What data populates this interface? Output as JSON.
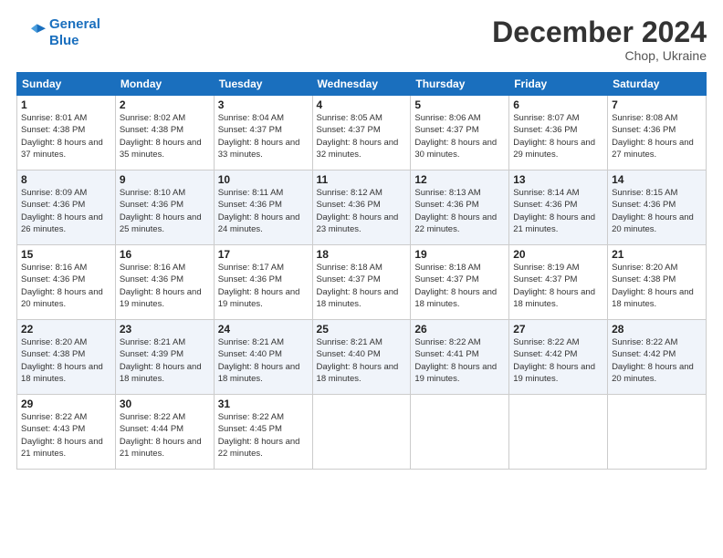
{
  "header": {
    "logo_line1": "General",
    "logo_line2": "Blue",
    "month": "December 2024",
    "location": "Chop, Ukraine"
  },
  "weekdays": [
    "Sunday",
    "Monday",
    "Tuesday",
    "Wednesday",
    "Thursday",
    "Friday",
    "Saturday"
  ],
  "weeks": [
    [
      {
        "day": "1",
        "sunrise": "8:01 AM",
        "sunset": "4:38 PM",
        "daylight": "8 hours and 37 minutes."
      },
      {
        "day": "2",
        "sunrise": "8:02 AM",
        "sunset": "4:38 PM",
        "daylight": "8 hours and 35 minutes."
      },
      {
        "day": "3",
        "sunrise": "8:04 AM",
        "sunset": "4:37 PM",
        "daylight": "8 hours and 33 minutes."
      },
      {
        "day": "4",
        "sunrise": "8:05 AM",
        "sunset": "4:37 PM",
        "daylight": "8 hours and 32 minutes."
      },
      {
        "day": "5",
        "sunrise": "8:06 AM",
        "sunset": "4:37 PM",
        "daylight": "8 hours and 30 minutes."
      },
      {
        "day": "6",
        "sunrise": "8:07 AM",
        "sunset": "4:36 PM",
        "daylight": "8 hours and 29 minutes."
      },
      {
        "day": "7",
        "sunrise": "8:08 AM",
        "sunset": "4:36 PM",
        "daylight": "8 hours and 27 minutes."
      }
    ],
    [
      {
        "day": "8",
        "sunrise": "8:09 AM",
        "sunset": "4:36 PM",
        "daylight": "8 hours and 26 minutes."
      },
      {
        "day": "9",
        "sunrise": "8:10 AM",
        "sunset": "4:36 PM",
        "daylight": "8 hours and 25 minutes."
      },
      {
        "day": "10",
        "sunrise": "8:11 AM",
        "sunset": "4:36 PM",
        "daylight": "8 hours and 24 minutes."
      },
      {
        "day": "11",
        "sunrise": "8:12 AM",
        "sunset": "4:36 PM",
        "daylight": "8 hours and 23 minutes."
      },
      {
        "day": "12",
        "sunrise": "8:13 AM",
        "sunset": "4:36 PM",
        "daylight": "8 hours and 22 minutes."
      },
      {
        "day": "13",
        "sunrise": "8:14 AM",
        "sunset": "4:36 PM",
        "daylight": "8 hours and 21 minutes."
      },
      {
        "day": "14",
        "sunrise": "8:15 AM",
        "sunset": "4:36 PM",
        "daylight": "8 hours and 20 minutes."
      }
    ],
    [
      {
        "day": "15",
        "sunrise": "8:16 AM",
        "sunset": "4:36 PM",
        "daylight": "8 hours and 20 minutes."
      },
      {
        "day": "16",
        "sunrise": "8:16 AM",
        "sunset": "4:36 PM",
        "daylight": "8 hours and 19 minutes."
      },
      {
        "day": "17",
        "sunrise": "8:17 AM",
        "sunset": "4:36 PM",
        "daylight": "8 hours and 19 minutes."
      },
      {
        "day": "18",
        "sunrise": "8:18 AM",
        "sunset": "4:37 PM",
        "daylight": "8 hours and 18 minutes."
      },
      {
        "day": "19",
        "sunrise": "8:18 AM",
        "sunset": "4:37 PM",
        "daylight": "8 hours and 18 minutes."
      },
      {
        "day": "20",
        "sunrise": "8:19 AM",
        "sunset": "4:37 PM",
        "daylight": "8 hours and 18 minutes."
      },
      {
        "day": "21",
        "sunrise": "8:20 AM",
        "sunset": "4:38 PM",
        "daylight": "8 hours and 18 minutes."
      }
    ],
    [
      {
        "day": "22",
        "sunrise": "8:20 AM",
        "sunset": "4:38 PM",
        "daylight": "8 hours and 18 minutes."
      },
      {
        "day": "23",
        "sunrise": "8:21 AM",
        "sunset": "4:39 PM",
        "daylight": "8 hours and 18 minutes."
      },
      {
        "day": "24",
        "sunrise": "8:21 AM",
        "sunset": "4:40 PM",
        "daylight": "8 hours and 18 minutes."
      },
      {
        "day": "25",
        "sunrise": "8:21 AM",
        "sunset": "4:40 PM",
        "daylight": "8 hours and 18 minutes."
      },
      {
        "day": "26",
        "sunrise": "8:22 AM",
        "sunset": "4:41 PM",
        "daylight": "8 hours and 19 minutes."
      },
      {
        "day": "27",
        "sunrise": "8:22 AM",
        "sunset": "4:42 PM",
        "daylight": "8 hours and 19 minutes."
      },
      {
        "day": "28",
        "sunrise": "8:22 AM",
        "sunset": "4:42 PM",
        "daylight": "8 hours and 20 minutes."
      }
    ],
    [
      {
        "day": "29",
        "sunrise": "8:22 AM",
        "sunset": "4:43 PM",
        "daylight": "8 hours and 21 minutes."
      },
      {
        "day": "30",
        "sunrise": "8:22 AM",
        "sunset": "4:44 PM",
        "daylight": "8 hours and 21 minutes."
      },
      {
        "day": "31",
        "sunrise": "8:22 AM",
        "sunset": "4:45 PM",
        "daylight": "8 hours and 22 minutes."
      },
      null,
      null,
      null,
      null
    ]
  ]
}
